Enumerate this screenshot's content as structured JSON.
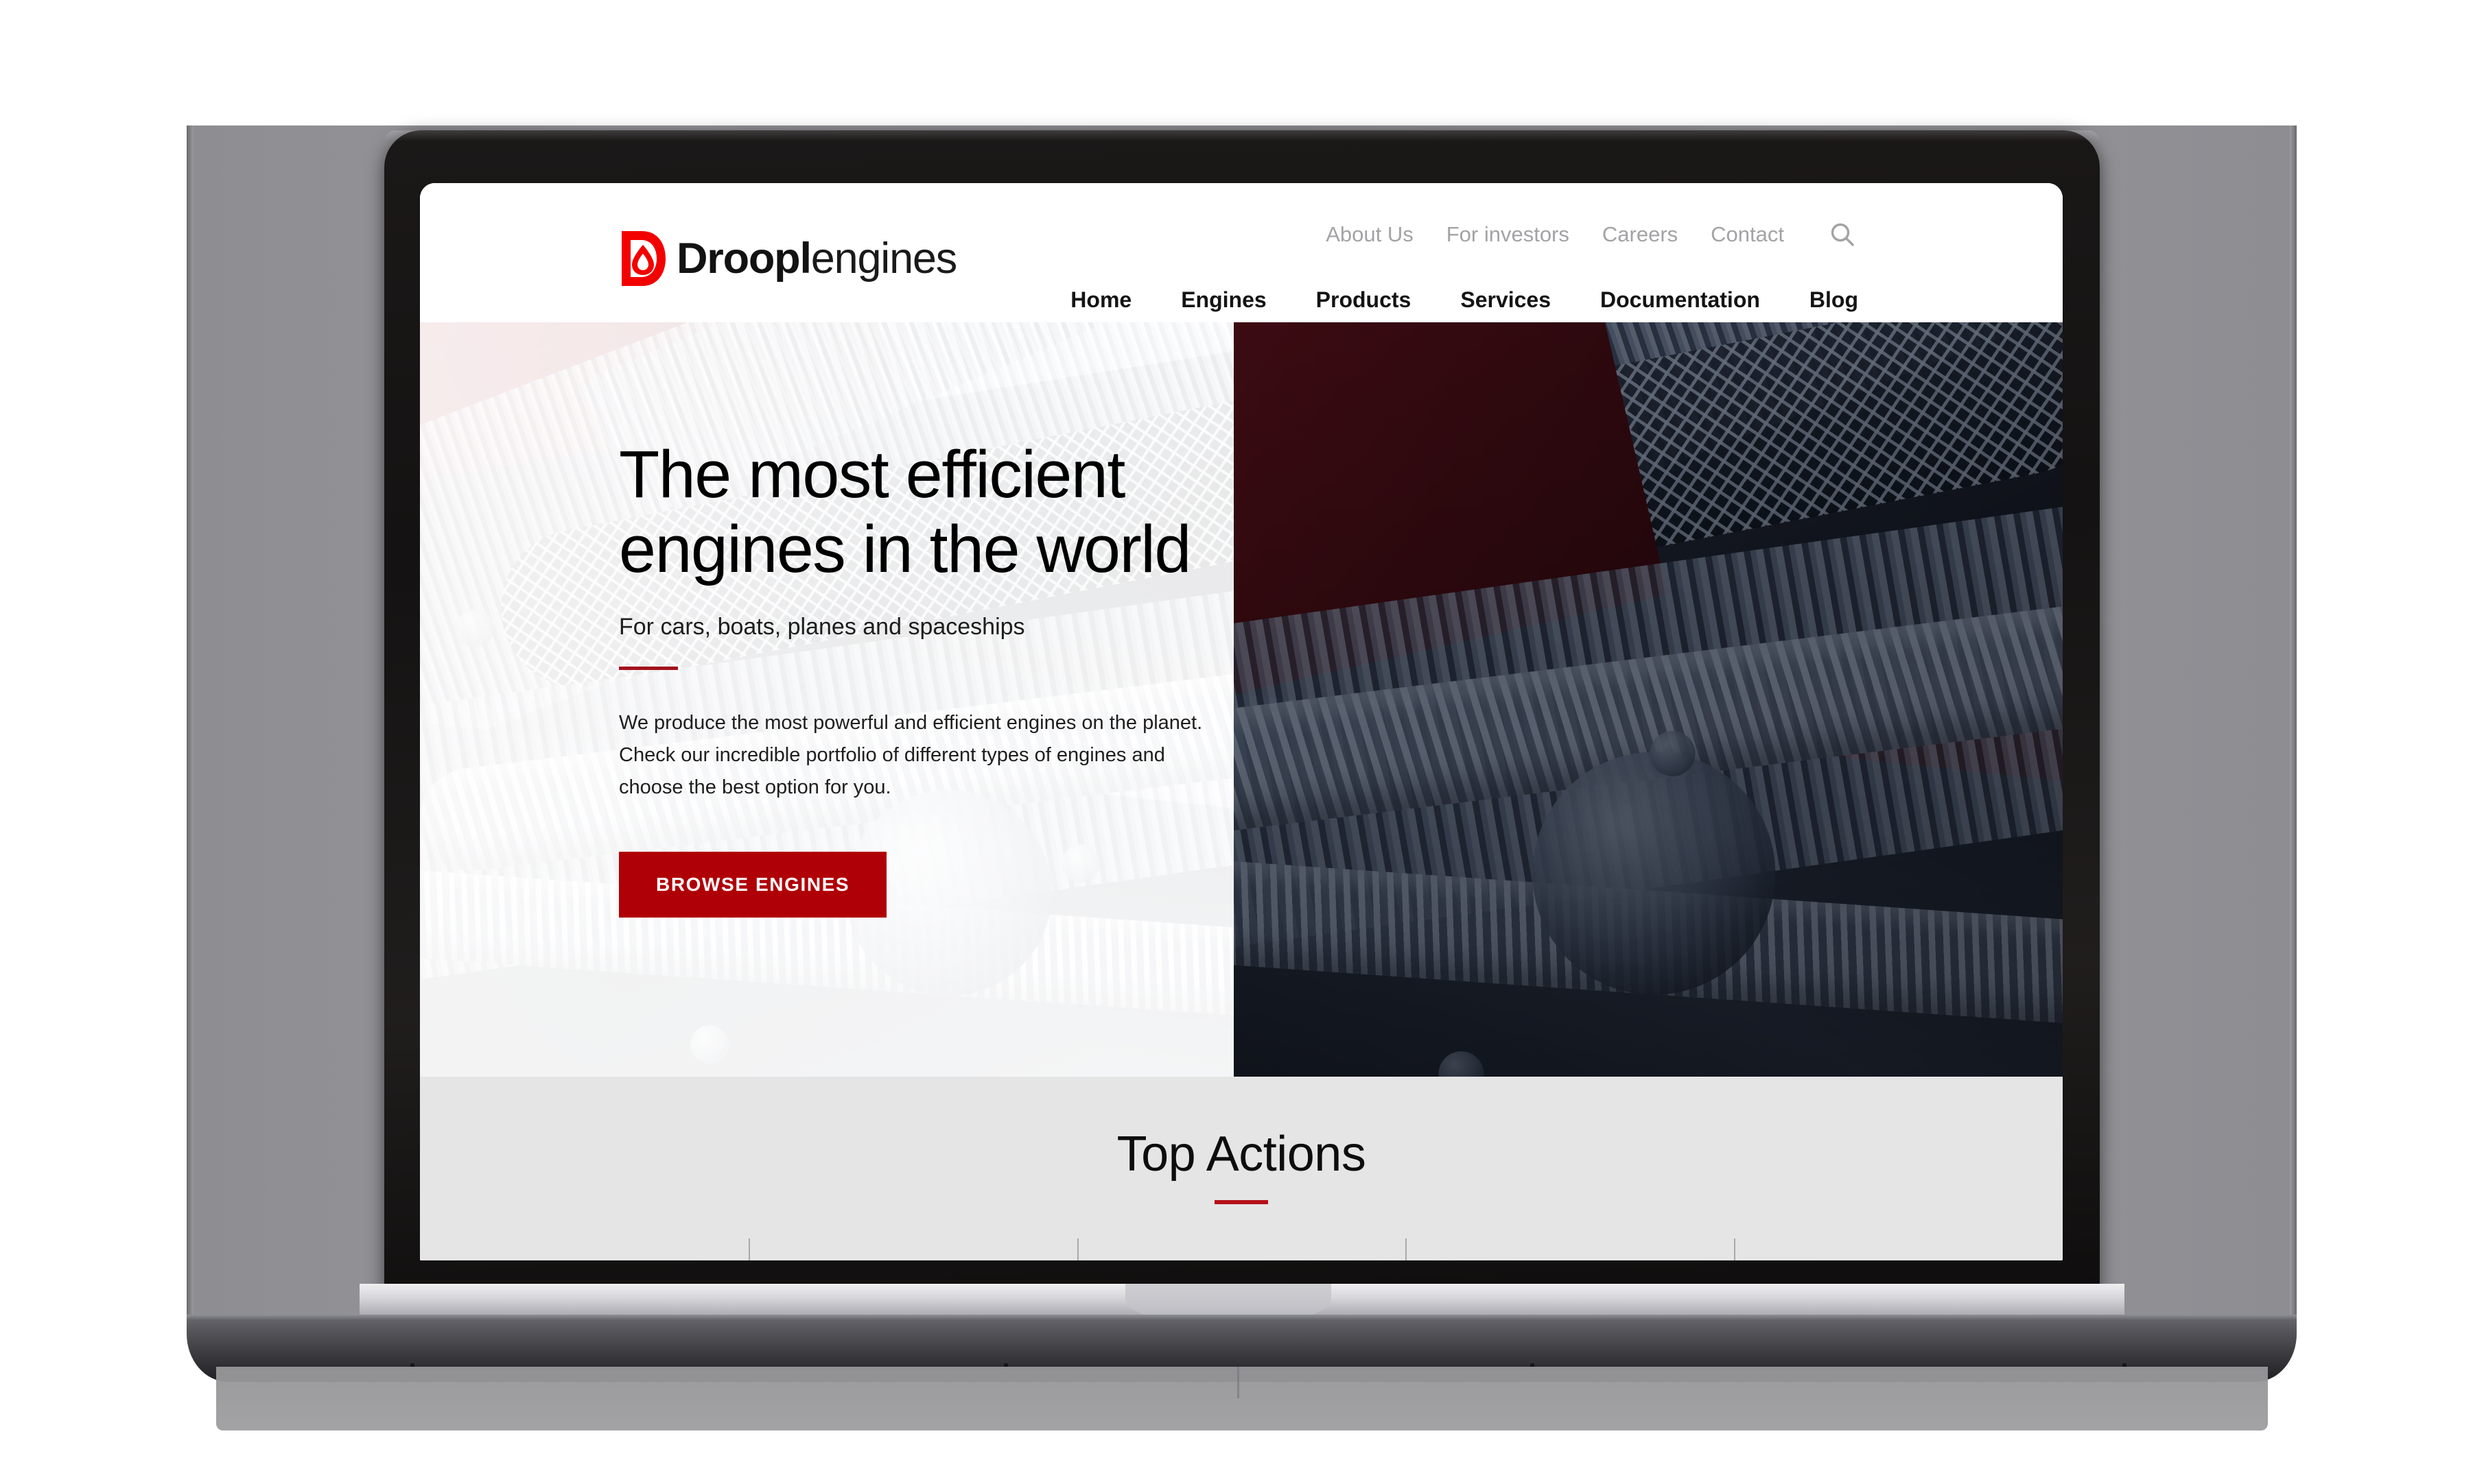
{
  "brand": {
    "name_bold": "Droopl",
    "name_light": "engines",
    "logo_icon": "droplet-d-logo-icon",
    "accent_red": "#b00007",
    "logo_red": "#f30000"
  },
  "header": {
    "utility_nav": [
      {
        "label": "About Us"
      },
      {
        "label": "For investors"
      },
      {
        "label": "Careers"
      },
      {
        "label": "Contact"
      }
    ],
    "search_icon": "search-icon",
    "main_nav": [
      {
        "label": "Home"
      },
      {
        "label": "Engines"
      },
      {
        "label": "Products"
      },
      {
        "label": "Services"
      },
      {
        "label": "Documentation"
      },
      {
        "label": "Blog"
      }
    ]
  },
  "hero": {
    "headline_line1": "The most efficient",
    "headline_line2": "engines in the world",
    "subtitle": "For cars, boats, planes and spaceships",
    "body": "We produce the most powerful and efficient engines on the planet. Check our incredible portfolio of different types of engines and choose the best option for you.",
    "cta_label": "BROWSE ENGINES",
    "background_alt": "engine-bay-photo"
  },
  "top_actions": {
    "title": "Top Actions",
    "column_count": 5
  },
  "device": {
    "type": "laptop-mockup",
    "bezel_color": "#141212",
    "backdrop_color": "#8e8e92",
    "base_color": "#3e3e43"
  }
}
